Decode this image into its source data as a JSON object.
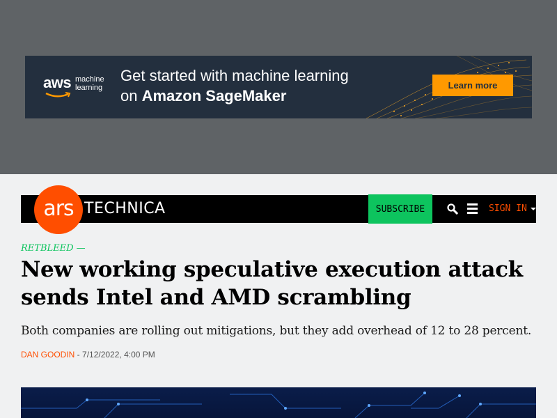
{
  "ad": {
    "brand": "aws",
    "brand_sub": "machine learning",
    "headline_line1": "Get started with machine learning",
    "headline_prefix": "on ",
    "headline_strong": "Amazon SageMaker",
    "cta": "Learn more",
    "colors": {
      "background": "#232f3e",
      "cta": "#ff9900"
    }
  },
  "nav": {
    "logo_ars": "ars",
    "logo_technica": "TECHNICA",
    "subscribe": "SUBSCRIBE",
    "search_icon": "search-icon",
    "menu_icon": "menu-icon",
    "signin": "SIGN IN",
    "colors": {
      "brand": "#ff4e00",
      "subscribe": "#0dc45e",
      "bar": "#000000"
    }
  },
  "article": {
    "kicker": "RETBLEED —",
    "headline": "New working speculative execution attack sends Intel and AMD scrambling",
    "dek": "Both companies are rolling out mitigations, but they add overhead of 12 to 28 percent.",
    "author": "Dan Goodin",
    "separator": " - ",
    "date": "7/12/2022, 4:00 PM"
  }
}
